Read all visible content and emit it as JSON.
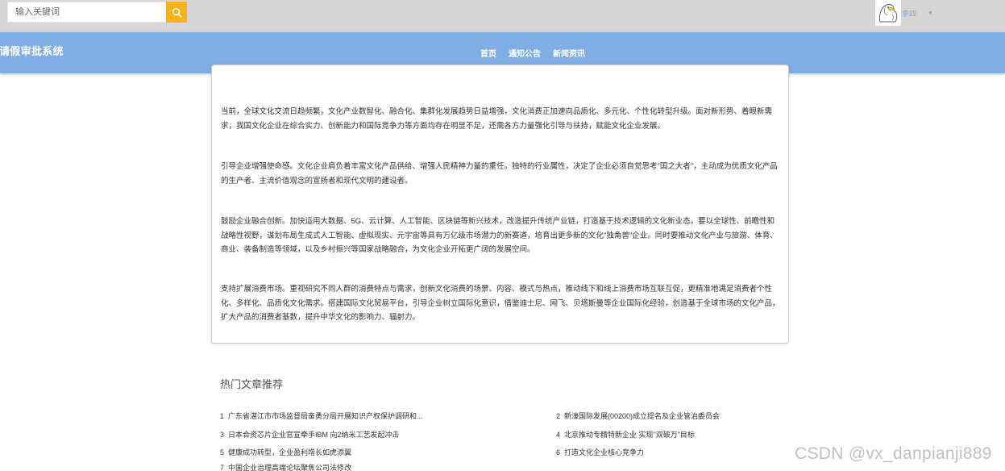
{
  "header": {
    "search": {
      "placeholder": "输入关键词",
      "value": ""
    },
    "user": {
      "name": "李四"
    }
  },
  "nav": {
    "brand": "请假审批系统",
    "links": [
      "首页",
      "通知公告",
      "新闻资讯"
    ]
  },
  "article": {
    "paragraphs": [
      "当前，全球文化交流日趋频繁，文化产业数智化、融合化、集群化发展趋势日益增强，文化消费正加速向品质化、多元化、个性化转型升级。面对新形势、着眼新需求，我国文化企业在综合实力、创新能力和国际竞争力等方面均存在明显不足，还需各方力量强化引导与扶持，赋能文化企业发展。",
      "引导企业增强使命感。文化企业肩负着丰富文化产品供给、增强人民精神力量的重任。独特的行业属性，决定了企业必须自觉思考\"国之大者\"，主动成为优质文化产品的生产者、主流价值观念的宣扬者和现代文明的建设者。",
      "鼓励企业融合创新。加快运用大数据、5G、云计算、人工智能、区块链等新兴技术，改造提升传统产业链，打造基于技术逻辑的文化新业态。要以全球性、前瞻性和战略性视野，谋划布局生成式人工智能、虚拟现实、元宇宙等具有万亿级市场潜力的新赛道，培育出更多新的文化\"独角兽\"企业。同时要推动文化产业与旅游、体育、商业、装备制造等领域，以及乡村振兴等国家战略融合，为文化企业开拓更广阔的发展空间。",
      "支持扩展消费市场。重视研究不同人群的消费特点与需求，创新文化消费的场景、内容、模式与热点，推动线下和线上消费市场互联互促，更精准地满足消费者个性化、多样化、品质化文化需求。搭建国际文化贸易平台，引导企业树立国际化意识，借鉴迪士尼、网飞、贝塔斯曼等企业国际化经验，创造基于全球市场的文化产品，扩大产品的消费者基数，提升中华文化的影响力、辐射力。"
    ]
  },
  "hot": {
    "title": "热门文章推荐",
    "items": [
      {
        "idx": "1",
        "title": "广东省湛江市市场监督局奋勇分局开展知识产权保护调研和..."
      },
      {
        "idx": "2",
        "title": "新濠国际发展(00200)成立提名及企业管治委员会"
      },
      {
        "idx": "3",
        "title": "日本合资芯片企业官宣牵手IBM 向2纳米工艺发起冲击"
      },
      {
        "idx": "4",
        "title": "北京推动专精特新企业 实现\"双破万\"目标"
      },
      {
        "idx": "5",
        "title": "健康成功转型，企业盈利增长如虎添翼"
      },
      {
        "idx": "6",
        "title": "打造文化企业核心竞争力"
      },
      {
        "idx": "7",
        "title": "中国企业治理高端论坛聚焦公司法修改"
      }
    ]
  },
  "watermark": "CSDN @vx_danpianji889",
  "colors": {
    "accent": "#f7b21a",
    "nav": "#7eaee3",
    "topbar": "#d6d6d6"
  }
}
